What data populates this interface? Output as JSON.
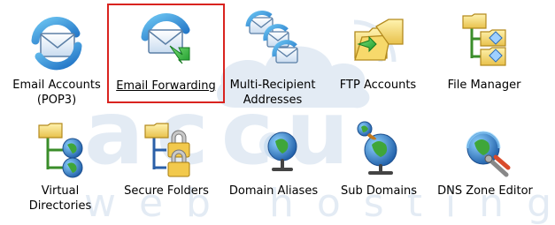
{
  "watermark": {
    "brand": "accu",
    "tagline": "web hosting"
  },
  "selection_color": "#d9231f",
  "items": [
    {
      "label": "Email Accounts\n(POP3)",
      "icon": "email-accounts-icon",
      "selected": false
    },
    {
      "label": "Email Forwarding",
      "icon": "email-forwarding-icon",
      "selected": true
    },
    {
      "label": "Multi-Recipient\nAddresses",
      "icon": "multi-recipient-icon",
      "selected": false
    },
    {
      "label": "FTP Accounts",
      "icon": "ftp-accounts-icon",
      "selected": false
    },
    {
      "label": "File Manager",
      "icon": "file-manager-icon",
      "selected": false
    },
    {
      "label": "Virtual\nDirectories",
      "icon": "virtual-directories-icon",
      "selected": false
    },
    {
      "label": "Secure Folders",
      "icon": "secure-folders-icon",
      "selected": false
    },
    {
      "label": "Domain Aliases",
      "icon": "domain-aliases-icon",
      "selected": false
    },
    {
      "label": "Sub Domains",
      "icon": "sub-domains-icon",
      "selected": false
    },
    {
      "label": "DNS Zone Editor",
      "icon": "dns-zone-editor-icon",
      "selected": false
    }
  ]
}
